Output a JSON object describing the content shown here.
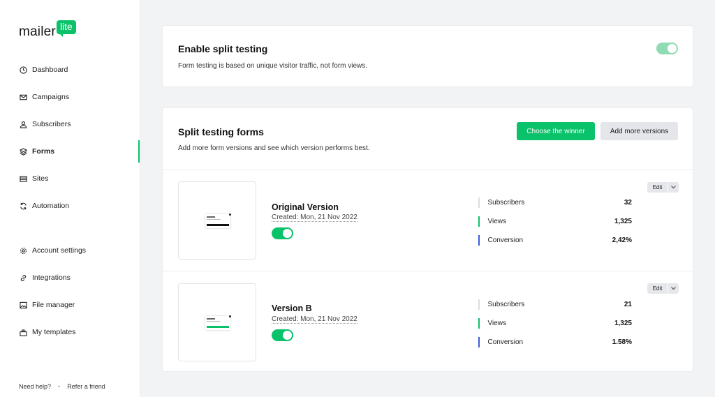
{
  "brand": {
    "word": "mailer",
    "badge": "lite",
    "accent": "#09c269"
  },
  "sidebar": {
    "items": [
      {
        "label": "Dashboard",
        "icon": "clock-icon"
      },
      {
        "label": "Campaigns",
        "icon": "envelope-icon"
      },
      {
        "label": "Subscribers",
        "icon": "user-icon"
      },
      {
        "label": "Forms",
        "icon": "layers-icon",
        "active": true
      },
      {
        "label": "Sites",
        "icon": "browser-icon"
      },
      {
        "label": "Automation",
        "icon": "refresh-icon"
      },
      {
        "label": "Account settings",
        "icon": "gear-icon"
      },
      {
        "label": "Integrations",
        "icon": "link-icon"
      },
      {
        "label": "File manager",
        "icon": "image-icon"
      },
      {
        "label": "My templates",
        "icon": "stack-icon"
      }
    ],
    "footer": {
      "help": "Need help?",
      "refer": "Refer a friend"
    }
  },
  "split": {
    "title": "Enable split testing",
    "description": "Form testing is based on unique visitor traffic, not form views.",
    "enabled": true
  },
  "forms": {
    "title": "Split testing forms",
    "description": "Add more form versions and see which version performs best.",
    "choose_winner": "Choose the winner",
    "add_versions": "Add more versions",
    "edit_label": "Edit",
    "versions": [
      {
        "name": "Original Version",
        "created": "Created: Mon, 21 Nov 2022",
        "enabled": true,
        "thumb_button_color": "#111111",
        "stats": [
          {
            "label": "Subscribers",
            "value": "32",
            "color": "#dddddd"
          },
          {
            "label": "Views",
            "value": "1,325",
            "color": "#09c269"
          },
          {
            "label": "Conversion",
            "value": "2,42%",
            "color": "#3b5bdb"
          }
        ]
      },
      {
        "name": "Version B",
        "created": "Created: Mon, 21 Nov 2022",
        "enabled": true,
        "thumb_button_color": "#09c269",
        "stats": [
          {
            "label": "Subscribers",
            "value": "21",
            "color": "#dddddd"
          },
          {
            "label": "Views",
            "value": "1,325",
            "color": "#09c269"
          },
          {
            "label": "Conversion",
            "value": "1.58%",
            "color": "#3b5bdb"
          }
        ]
      }
    ]
  }
}
